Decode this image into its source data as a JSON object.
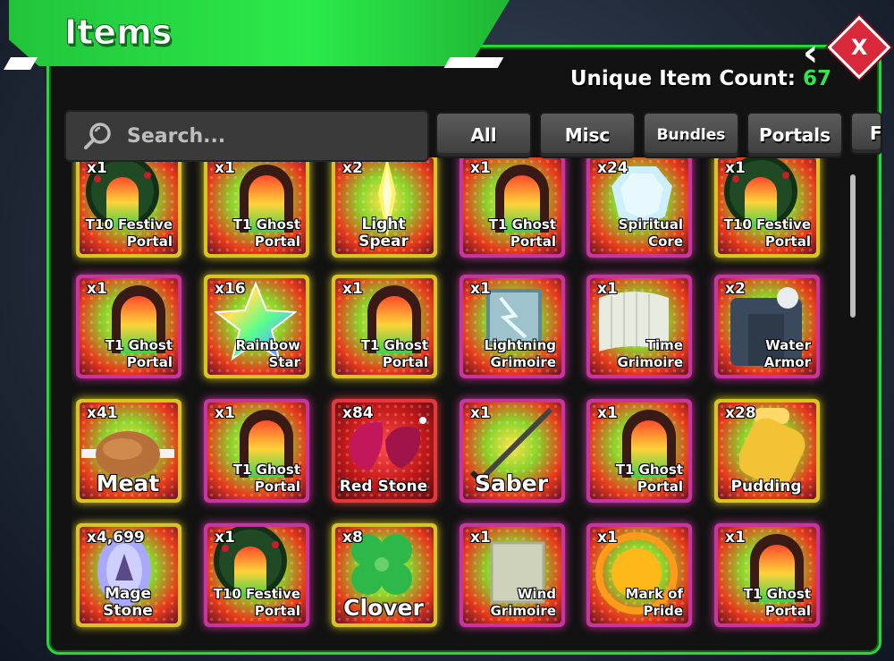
{
  "window": {
    "title": "Items"
  },
  "header": {
    "count_label": "Unique Item Count:",
    "count_value": "67",
    "count_color": "#30e84a"
  },
  "close": {
    "label": "X"
  },
  "search": {
    "placeholder": "Search..."
  },
  "tabs": [
    "All",
    "Misc",
    "Bundles",
    "Portals",
    "F"
  ],
  "items": [
    {
      "qty": "x1",
      "name": "T10 Festive Portal",
      "icon": "festive-portal-icon"
    },
    {
      "qty": "x1",
      "name": "T1 Ghost Portal",
      "icon": "ghost-portal-icon"
    },
    {
      "qty": "x2",
      "name": "Light Spear",
      "icon": "light-spear-icon"
    },
    {
      "qty": "x1",
      "name": "T1 Ghost Portal",
      "icon": "ghost-portal-icon"
    },
    {
      "qty": "x24",
      "name": "Spiritual Core",
      "icon": "spiritual-core-icon"
    },
    {
      "qty": "x1",
      "name": "T10 Festive Portal",
      "icon": "festive-portal-icon"
    },
    {
      "qty": "x1",
      "name": "T1 Ghost Portal",
      "icon": "ghost-portal-icon"
    },
    {
      "qty": "x16",
      "name": "Rainbow Star",
      "icon": "rainbow-star-icon"
    },
    {
      "qty": "x1",
      "name": "T1 Ghost Portal",
      "icon": "ghost-portal-icon"
    },
    {
      "qty": "x1",
      "name": "Lightning Grimoire",
      "icon": "lightning-grimoire-icon"
    },
    {
      "qty": "x1",
      "name": "Time Grimoire",
      "icon": "time-grimoire-icon"
    },
    {
      "qty": "x2",
      "name": "Water Armor",
      "icon": "water-armor-icon"
    },
    {
      "qty": "x41",
      "name": "Meat",
      "icon": "meat-icon"
    },
    {
      "qty": "x1",
      "name": "T1 Ghost Portal",
      "icon": "ghost-portal-icon"
    },
    {
      "qty": "x84",
      "name": "Red Stone",
      "icon": "red-stone-icon"
    },
    {
      "qty": "x1",
      "name": "Saber",
      "icon": "saber-icon"
    },
    {
      "qty": "x1",
      "name": "T1 Ghost Portal",
      "icon": "ghost-portal-icon"
    },
    {
      "qty": "x28",
      "name": "Pudding",
      "icon": "pudding-icon"
    },
    {
      "qty": "x4,699",
      "name": "Mage Stone",
      "icon": "mage-stone-icon"
    },
    {
      "qty": "x1",
      "name": "T10 Festive Portal",
      "icon": "festive-portal-icon"
    },
    {
      "qty": "x8",
      "name": "Clover",
      "icon": "clover-icon"
    },
    {
      "qty": "x1",
      "name": "Wind Grimoire",
      "icon": "wind-grimoire-icon"
    },
    {
      "qty": "x1",
      "name": "Mark of Pride",
      "icon": "mark-of-pride-icon"
    },
    {
      "qty": "x1",
      "name": "T1 Ghost Portal",
      "icon": "ghost-portal-icon"
    }
  ]
}
